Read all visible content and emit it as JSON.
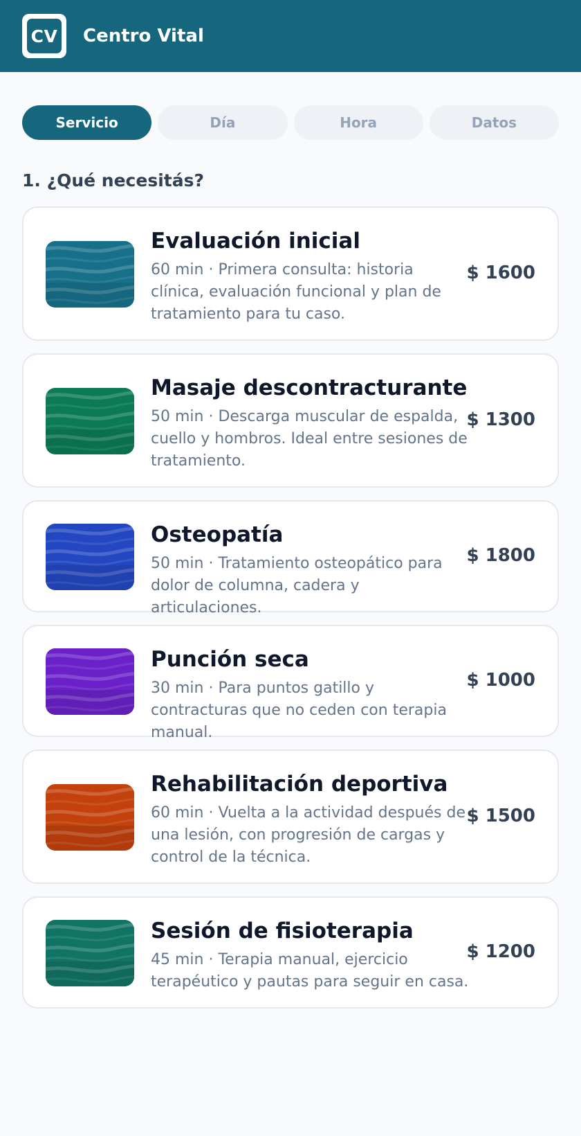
{
  "header": {
    "logo_text": "CV",
    "title": "Centro Vital",
    "color": "#16677e"
  },
  "steps": [
    {
      "label": "Servicio",
      "active": true
    },
    {
      "label": "Día",
      "active": false
    },
    {
      "label": "Hora",
      "active": false
    },
    {
      "label": "Datos",
      "active": false
    }
  ],
  "section_title": "1. ¿Qué necesitás?",
  "services": [
    {
      "name": "Evaluación inicial",
      "description": "60 min · Primera consulta: historia clínica, evaluación funcional y plan de tratamiento para tu caso.",
      "price": "$ 1600",
      "thumb_color": "#16708a"
    },
    {
      "name": "Masaje descontracturante",
      "description": "50 min · Descarga muscular de espalda, cuello y hombros. Ideal entre sesiones de tratamiento.",
      "price": "$ 1300",
      "thumb_color": "#0b7a55"
    },
    {
      "name": "Osteopatía",
      "description": "50 min · Tratamiento osteopático para dolor de columna, cadera y articulaciones.",
      "price": "$ 1800",
      "thumb_color": "#2247c0"
    },
    {
      "name": "Punción seca",
      "description": "30 min · Para puntos gatillo y contracturas que no ceden con terapia manual.",
      "price": "$ 1000",
      "thumb_color": "#6a22c8"
    },
    {
      "name": "Rehabilitación deportiva",
      "description": "60 min · Vuelta a la actividad después de una lesión, con progresión de cargas y control de la técnica.",
      "price": "$ 1500",
      "thumb_color": "#c2410c"
    },
    {
      "name": "Sesión de fisioterapia",
      "description": "45 min · Terapia manual, ejercicio terapéutico y pautas para seguir en casa.",
      "price": "$ 1200",
      "thumb_color": "#117363"
    }
  ]
}
